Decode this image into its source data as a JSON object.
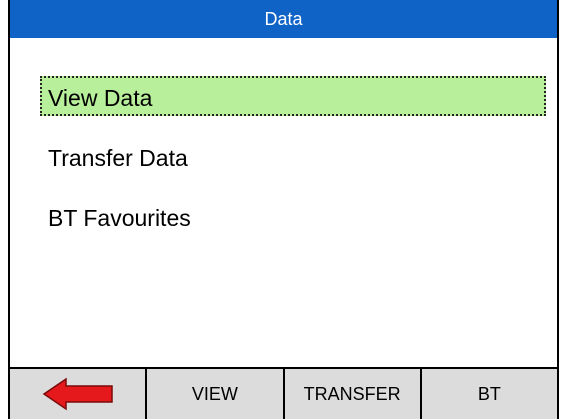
{
  "title": "Data",
  "colors": {
    "title_bar": "#0f63c7",
    "selected_item": "#b8ef9a",
    "softkey_bar": "#dcdcdc",
    "back_arrow": "#e5191c"
  },
  "menu": {
    "items": [
      {
        "label": "View Data",
        "selected": true
      },
      {
        "label": "Transfer Data",
        "selected": false
      },
      {
        "label": "BT Favourites",
        "selected": false
      }
    ]
  },
  "softkeys": {
    "back_icon": "left-arrow-icon",
    "view": "VIEW",
    "transfer": "TRANSFER",
    "bt": "BT"
  }
}
